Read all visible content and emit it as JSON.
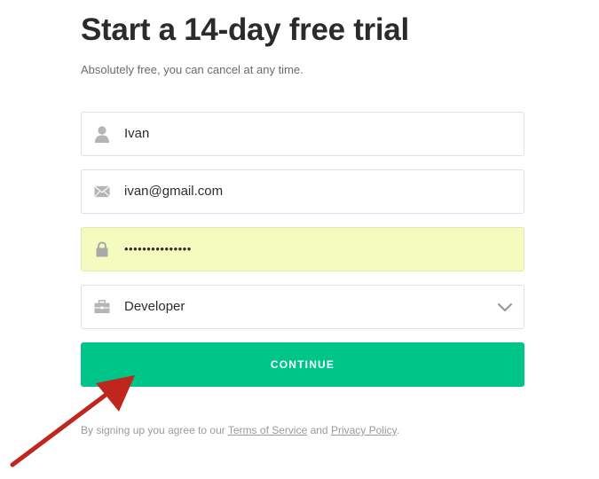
{
  "header": {
    "title": "Start a 14-day free trial",
    "subtitle": "Absolutely free, you can cancel at any time."
  },
  "form": {
    "name": {
      "value": "Ivan",
      "icon": "user-icon"
    },
    "email": {
      "value": "ivan@gmail.com",
      "icon": "envelope-icon"
    },
    "password": {
      "value": "•••••••••••••••",
      "icon": "lock-icon"
    },
    "role": {
      "value": "Developer",
      "icon": "briefcase-icon"
    },
    "continue_label": "CONTINUE"
  },
  "terms": {
    "prefix": "By signing up you agree to our ",
    "terms_link": "Terms of Service",
    "middle": " and ",
    "privacy_link": "Privacy Policy",
    "suffix": "."
  },
  "colors": {
    "accent": "#00c589",
    "autofill": "#f3fbbf",
    "arrow": "#c0271c"
  }
}
